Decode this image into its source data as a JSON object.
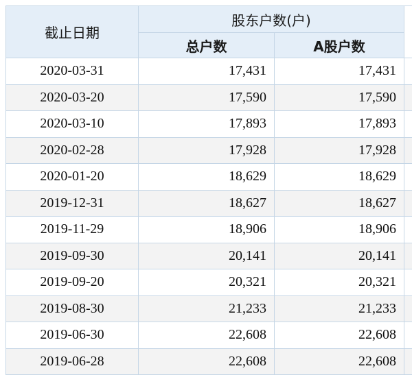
{
  "table": {
    "header": {
      "date_label": "截止日期",
      "group_label": "股东户数(户)",
      "total_label": "总户数",
      "a_label": "A股户数"
    },
    "rows": [
      {
        "date": "2020-03-31",
        "total": "17,431",
        "a": "17,431"
      },
      {
        "date": "2020-03-20",
        "total": "17,590",
        "a": "17,590"
      },
      {
        "date": "2020-03-10",
        "total": "17,893",
        "a": "17,893"
      },
      {
        "date": "2020-02-28",
        "total": "17,928",
        "a": "17,928"
      },
      {
        "date": "2020-01-20",
        "total": "18,629",
        "a": "18,629"
      },
      {
        "date": "2019-12-31",
        "total": "18,627",
        "a": "18,627"
      },
      {
        "date": "2019-11-29",
        "total": "18,906",
        "a": "18,906"
      },
      {
        "date": "2019-09-30",
        "total": "20,141",
        "a": "20,141"
      },
      {
        "date": "2019-09-20",
        "total": "20,321",
        "a": "20,321"
      },
      {
        "date": "2019-08-30",
        "total": "21,233",
        "a": "21,233"
      },
      {
        "date": "2019-06-30",
        "total": "22,608",
        "a": "22,608"
      },
      {
        "date": "2019-06-28",
        "total": "22,608",
        "a": "22,608"
      }
    ]
  },
  "colors": {
    "header_bg": "#e4eef8",
    "border": "#c5d6e6",
    "stripe": "#f3f3f3"
  }
}
